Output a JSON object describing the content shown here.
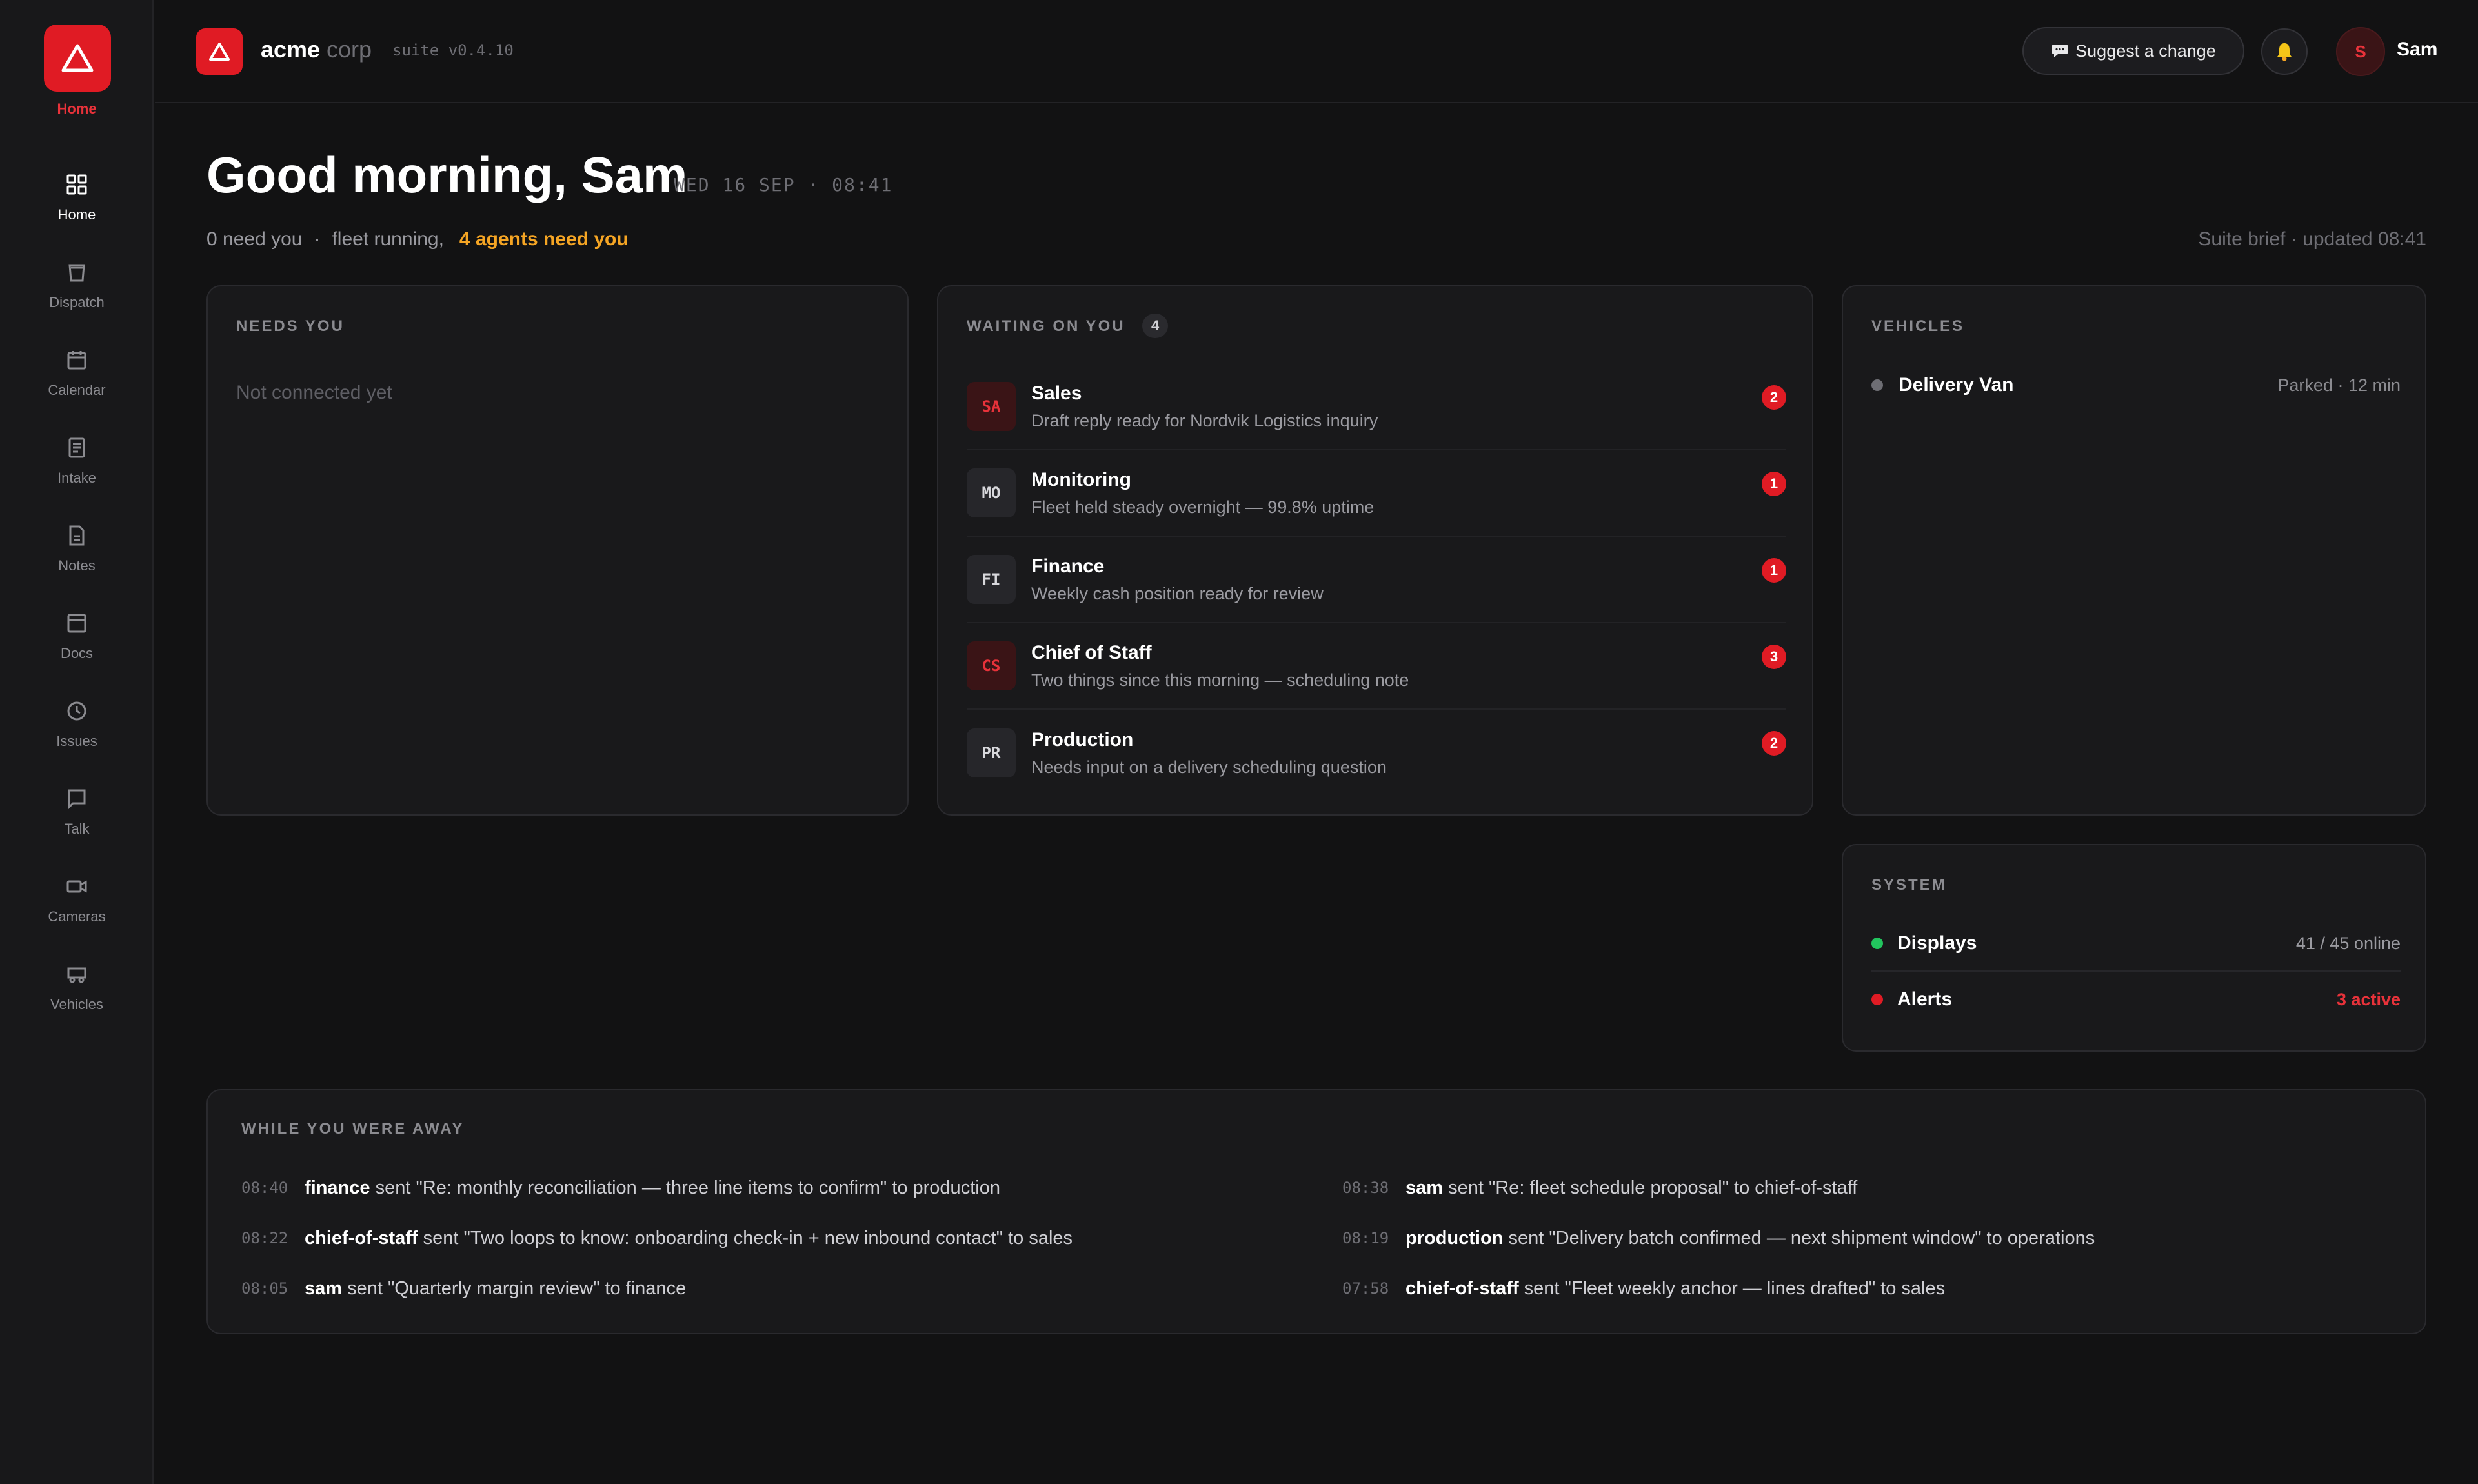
{
  "app": {
    "logo_label": "Home",
    "brand_name": "acme",
    "brand_sub": "corp",
    "version": "suite v0.4.10",
    "accent_color": "#e01b24"
  },
  "sidebar": {
    "items": [
      {
        "label": "Home",
        "icon": "grid-icon",
        "active": true
      },
      {
        "label": "Dispatch",
        "icon": "bag-icon"
      },
      {
        "label": "Calendar",
        "icon": "calendar-icon"
      },
      {
        "label": "Intake",
        "icon": "form-icon"
      },
      {
        "label": "Notes",
        "icon": "note-icon"
      },
      {
        "label": "Docs",
        "icon": "doc-icon"
      },
      {
        "label": "Issues",
        "icon": "clock-icon"
      },
      {
        "label": "Talk",
        "icon": "chat-icon"
      },
      {
        "label": "Cameras",
        "icon": "camera-icon"
      },
      {
        "label": "Vehicles",
        "icon": "truck-icon"
      }
    ]
  },
  "topbar": {
    "suggest_label": "Suggest a change",
    "user_initial": "S",
    "user_name": "Sam"
  },
  "header": {
    "greeting": "Good morning, Sam",
    "date": "WED 16 SEP · 08:41",
    "need_you": "0 need you",
    "separator": "·",
    "fleet": "fleet running,",
    "agents_need": "4 agents need you",
    "brief": "Suite brief · updated 08:41"
  },
  "needs_you": {
    "title": "NEEDS YOU",
    "empty_text": "Not connected yet"
  },
  "waiting": {
    "title": "WAITING ON YOU",
    "count": "4",
    "agents": [
      {
        "code": "SA",
        "name": "Sales",
        "desc": "Draft reply ready for Nordvik Logistics inquiry",
        "badge": "2",
        "tone": "red"
      },
      {
        "code": "MO",
        "name": "Monitoring",
        "desc": "Fleet held steady overnight — 99.8% uptime",
        "badge": "1",
        "tone": "neutral"
      },
      {
        "code": "FI",
        "name": "Finance",
        "desc": "Weekly cash position ready for review",
        "badge": "1",
        "tone": "neutral"
      },
      {
        "code": "CS",
        "name": "Chief of Staff",
        "desc": "Two things since this morning — scheduling note",
        "badge": "3",
        "tone": "red"
      },
      {
        "code": "PR",
        "name": "Production",
        "desc": "Needs input on a delivery scheduling question",
        "badge": "2",
        "tone": "neutral"
      }
    ]
  },
  "vehicles": {
    "title": "VEHICLES",
    "items": [
      {
        "name": "Delivery Van",
        "status": "Parked · 12 min",
        "dot_color": "#6e6e74"
      }
    ]
  },
  "system": {
    "title": "SYSTEM",
    "items": [
      {
        "name": "Displays",
        "value": "41 / 45 online",
        "dot_color": "#22c55e",
        "alert": false
      },
      {
        "name": "Alerts",
        "value": "3 active",
        "dot_color": "#e01b24",
        "alert": true
      }
    ]
  },
  "away": {
    "title": "WHILE YOU WERE AWAY",
    "left": [
      {
        "time": "08:40",
        "sender": "finance",
        "text": " sent \"Re: monthly reconciliation — three line items to confirm\" to production"
      },
      {
        "time": "08:22",
        "sender": "chief-of-staff",
        "text": " sent \"Two loops to know: onboarding check-in + new inbound contact\" to sales"
      },
      {
        "time": "08:05",
        "sender": "sam",
        "text": " sent \"Quarterly margin review\" to finance"
      }
    ],
    "right": [
      {
        "time": "08:38",
        "sender": "sam",
        "text": " sent \"Re: fleet schedule proposal\" to chief-of-staff"
      },
      {
        "time": "08:19",
        "sender": "production",
        "text": " sent \"Delivery batch confirmed — next shipment window\" to operations"
      },
      {
        "time": "07:58",
        "sender": "chief-of-staff",
        "text": " sent \"Fleet weekly anchor — lines drafted\" to sales"
      }
    ]
  }
}
